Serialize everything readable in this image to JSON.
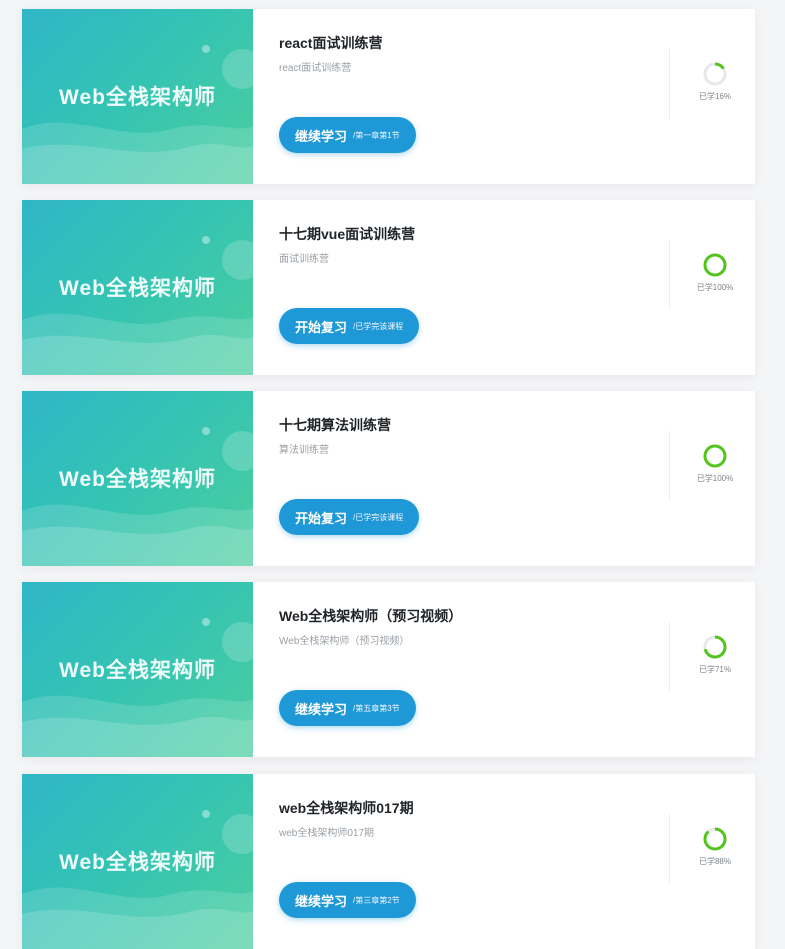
{
  "accent_color": "#1f98d8",
  "progress_color": "#52c41a",
  "courses": [
    {
      "thumb_text": "Web全栈架构师",
      "title": "react面试训练营",
      "subtitle": "react面试训练营",
      "button_label": "继续学习",
      "button_sub": "/第一章第1节",
      "progress_label": "已学16%",
      "progress": 16
    },
    {
      "thumb_text": "Web全栈架构师",
      "title": "十七期vue面试训练营",
      "subtitle": "面试训练营",
      "button_label": "开始复习",
      "button_sub": "/已学完该课程",
      "progress_label": "已学100%",
      "progress": 100
    },
    {
      "thumb_text": "Web全栈架构师",
      "title": "十七期算法训练营",
      "subtitle": "算法训练营",
      "button_label": "开始复习",
      "button_sub": "/已学完该课程",
      "progress_label": "已学100%",
      "progress": 100
    },
    {
      "thumb_text": "Web全栈架构师",
      "title": "Web全栈架构师（预习视频）",
      "subtitle": "Web全栈架构师（预习视频）",
      "button_label": "继续学习",
      "button_sub": "/第五章第3节",
      "progress_label": "已学71%",
      "progress": 71
    },
    {
      "thumb_text": "Web全栈架构师",
      "title": "web全栈架构师017期",
      "subtitle": "web全栈架构师017期",
      "button_label": "继续学习",
      "button_sub": "/第三章第2节",
      "progress_label": "已学88%",
      "progress": 88
    }
  ]
}
